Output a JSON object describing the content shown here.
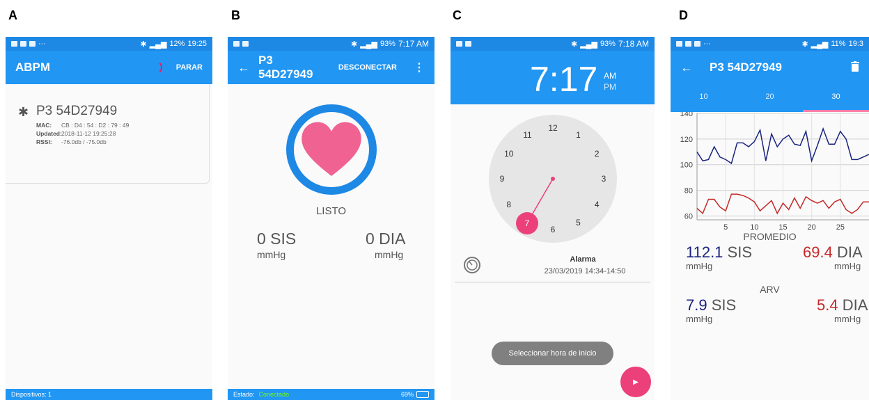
{
  "panels": [
    "A",
    "B",
    "C",
    "D"
  ],
  "colors": {
    "primary": "#2196f3",
    "statusbar": "#1e88e5",
    "accent_pink": "#ec407a",
    "sis_blue": "#1a237e",
    "dia_red": "#c62828"
  },
  "screenA": {
    "status_time": "19:25",
    "status_battery": "12%",
    "title": "ABPM",
    "action": "PARAR",
    "device": {
      "icon": "bluetooth-icon",
      "name": "P3 54D27949",
      "mac_label": "MAC:",
      "mac_value": "CB : D4 : 54 : D2 : 79 : 49",
      "updated_label": "Updated:",
      "updated_value": "2018-11-12 19:25:28",
      "rssi_label": "RSSI:",
      "rssi_value": "-76.0db / -75.0db"
    },
    "bottom": "Dispositivos: 1"
  },
  "screenB": {
    "status_time": "7:17 AM",
    "status_battery": "93%",
    "title": "P3 54D27949",
    "action": "DESCONECTAR",
    "status_text": "LISTO",
    "sis_value": "0 SIS",
    "sis_unit": "mmHg",
    "dia_value": "0 DIA",
    "dia_unit": "mmHg",
    "bottom_label": "Estado:",
    "bottom_state": "Conectado",
    "bottom_battery": "69%"
  },
  "screenC": {
    "status_time": "7:18 AM",
    "status_battery": "93%",
    "time_display": "7:17",
    "am": "AM",
    "pm": "PM",
    "clock_numbers": [
      "12",
      "1",
      "2",
      "3",
      "4",
      "5",
      "6",
      "7",
      "8",
      "9",
      "10",
      "11"
    ],
    "selected_hour": "7",
    "alarm_title": "Alarma",
    "alarm_date": "23/03/2019 14:34-14:50",
    "toast": "Seleccionar hora de inicio"
  },
  "screenD": {
    "status_time": "19:3",
    "status_battery": "11%",
    "title": "P3 54D27949",
    "tabs": [
      "10",
      "20",
      "30"
    ],
    "active_tab": 2,
    "promedio_label": "PROMEDIO",
    "prom_sis": "112.1",
    "prom_dia": "69.4",
    "arv_label": "ARV",
    "arv_sis": "7.9",
    "arv_dia": "5.4",
    "sis_suffix": "SIS",
    "dia_suffix": "DIA",
    "unit": "mmHg"
  },
  "chart_data": {
    "type": "line",
    "x_ticks": [
      "5",
      "10",
      "15",
      "20",
      "25"
    ],
    "y_ticks": [
      "60",
      "80",
      "100",
      "120",
      "140"
    ],
    "xlim": [
      0,
      30
    ],
    "ylim": [
      57,
      140
    ],
    "grid": true,
    "series": [
      {
        "color": "#1a237e",
        "values": [
          110,
          103,
          104,
          114,
          106,
          104,
          101,
          117,
          117,
          114,
          118,
          127,
          103,
          124,
          114,
          120,
          123,
          116,
          115,
          126,
          103,
          115,
          128,
          116,
          116,
          126,
          120,
          104,
          104,
          106,
          108
        ]
      },
      {
        "color": "#c62828",
        "values": [
          66,
          62,
          73,
          73,
          67,
          64,
          77,
          77,
          76,
          74,
          71,
          64,
          68,
          72,
          62,
          70,
          65,
          74,
          66,
          75,
          72,
          70,
          72,
          66,
          71,
          73,
          65,
          62,
          65,
          71,
          71
        ]
      }
    ]
  }
}
